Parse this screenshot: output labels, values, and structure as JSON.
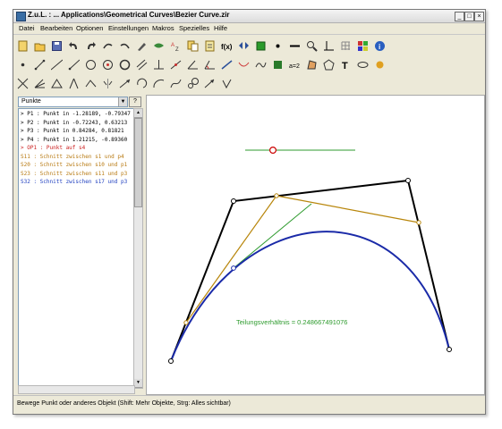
{
  "window": {
    "title": "Z.u.L. : ... Applications\\Geometrical Curves\\Bezier Curve.zir",
    "controls": [
      "_",
      "□",
      "×"
    ]
  },
  "menu": [
    "Datei",
    "Bearbeiten",
    "Optionen",
    "Einstellungen",
    "Makros",
    "Spezielles",
    "Hilfe"
  ],
  "toolbar": {
    "row1": [
      "new-icon",
      "open-icon",
      "save-icon",
      "undo-icon",
      "redo-icon",
      "back-icon",
      "forward-icon",
      "delete-icon",
      "hide-icon",
      "sort-icon",
      "copy-icon",
      "paste-icon",
      "function-icon",
      "view-icon",
      "color-icon",
      "point-style-icon",
      "line-style-icon",
      "zoom-icon",
      "axis-icon",
      "grid-icon",
      "palette-icon",
      "info-icon"
    ],
    "row2": [
      "point-icon",
      "segment-icon",
      "line-icon",
      "ray-icon",
      "circle-icon",
      "circle3-icon",
      "fixed-circle-icon",
      "parallel-icon",
      "perpendicular-icon",
      "midpoint-icon",
      "angle-icon",
      "fixed-angle-icon",
      "move-icon",
      "tracker-icon",
      "locus-icon",
      "animate-icon",
      "expression-icon",
      "polygon-icon",
      "area-icon",
      "text-icon",
      "quadric-icon",
      "macro-icon"
    ],
    "row3": [
      "intersection-icon",
      "bisector-icon",
      "triangle-icon",
      "compass-icon",
      "transfer-icon",
      "reflect-icon",
      "translate-icon",
      "rotate-icon",
      "arc-icon",
      "function-plot-icon",
      "dilate-icon",
      "vector-icon",
      "parameter-icon"
    ],
    "function_label": "f(x)",
    "text_label": "T"
  },
  "sidebar": {
    "dropdown_value": "Punkte",
    "help_label": "?",
    "items": [
      {
        "text": "> P1 : Punkt in -1.28189, -0.79347",
        "color": "#000000"
      },
      {
        "text": "> P2 : Punkt in -0.72243, 0.63213",
        "color": "#000000"
      },
      {
        "text": "> P3 : Punkt in 0.84284, 0.81821",
        "color": "#000000"
      },
      {
        "text": "> P4 : Punkt in 1.21215, -0.89360",
        "color": "#000000"
      },
      {
        "text": "> OP1 : Punkt auf s4",
        "color": "#cc2222"
      },
      {
        "text": "S11 : Schnitt zwischen s1 und p4",
        "color": "#b87a12"
      },
      {
        "text": "S20 : Schnitt zwischen s10 und p1",
        "color": "#b87a12"
      },
      {
        "text": "S23 : Schnitt zwischen s11 und p3",
        "color": "#b87a12"
      },
      {
        "text": "S32 : Schnitt zwischen s17 und p3",
        "color": "#2040c0"
      }
    ]
  },
  "canvas": {
    "ratio_label": "Teilungsverhältnis = 0.248667491076",
    "colors": {
      "polygon": "#000000",
      "construction": "#b8860b",
      "tangent": "#2e9b2e",
      "curve": "#1a2aa8",
      "slider_point": "#cc0000"
    }
  },
  "status": "Bewege Punkt oder anderes Objekt (Shift: Mehr Objekte, Strg: Alles sichtbar)"
}
